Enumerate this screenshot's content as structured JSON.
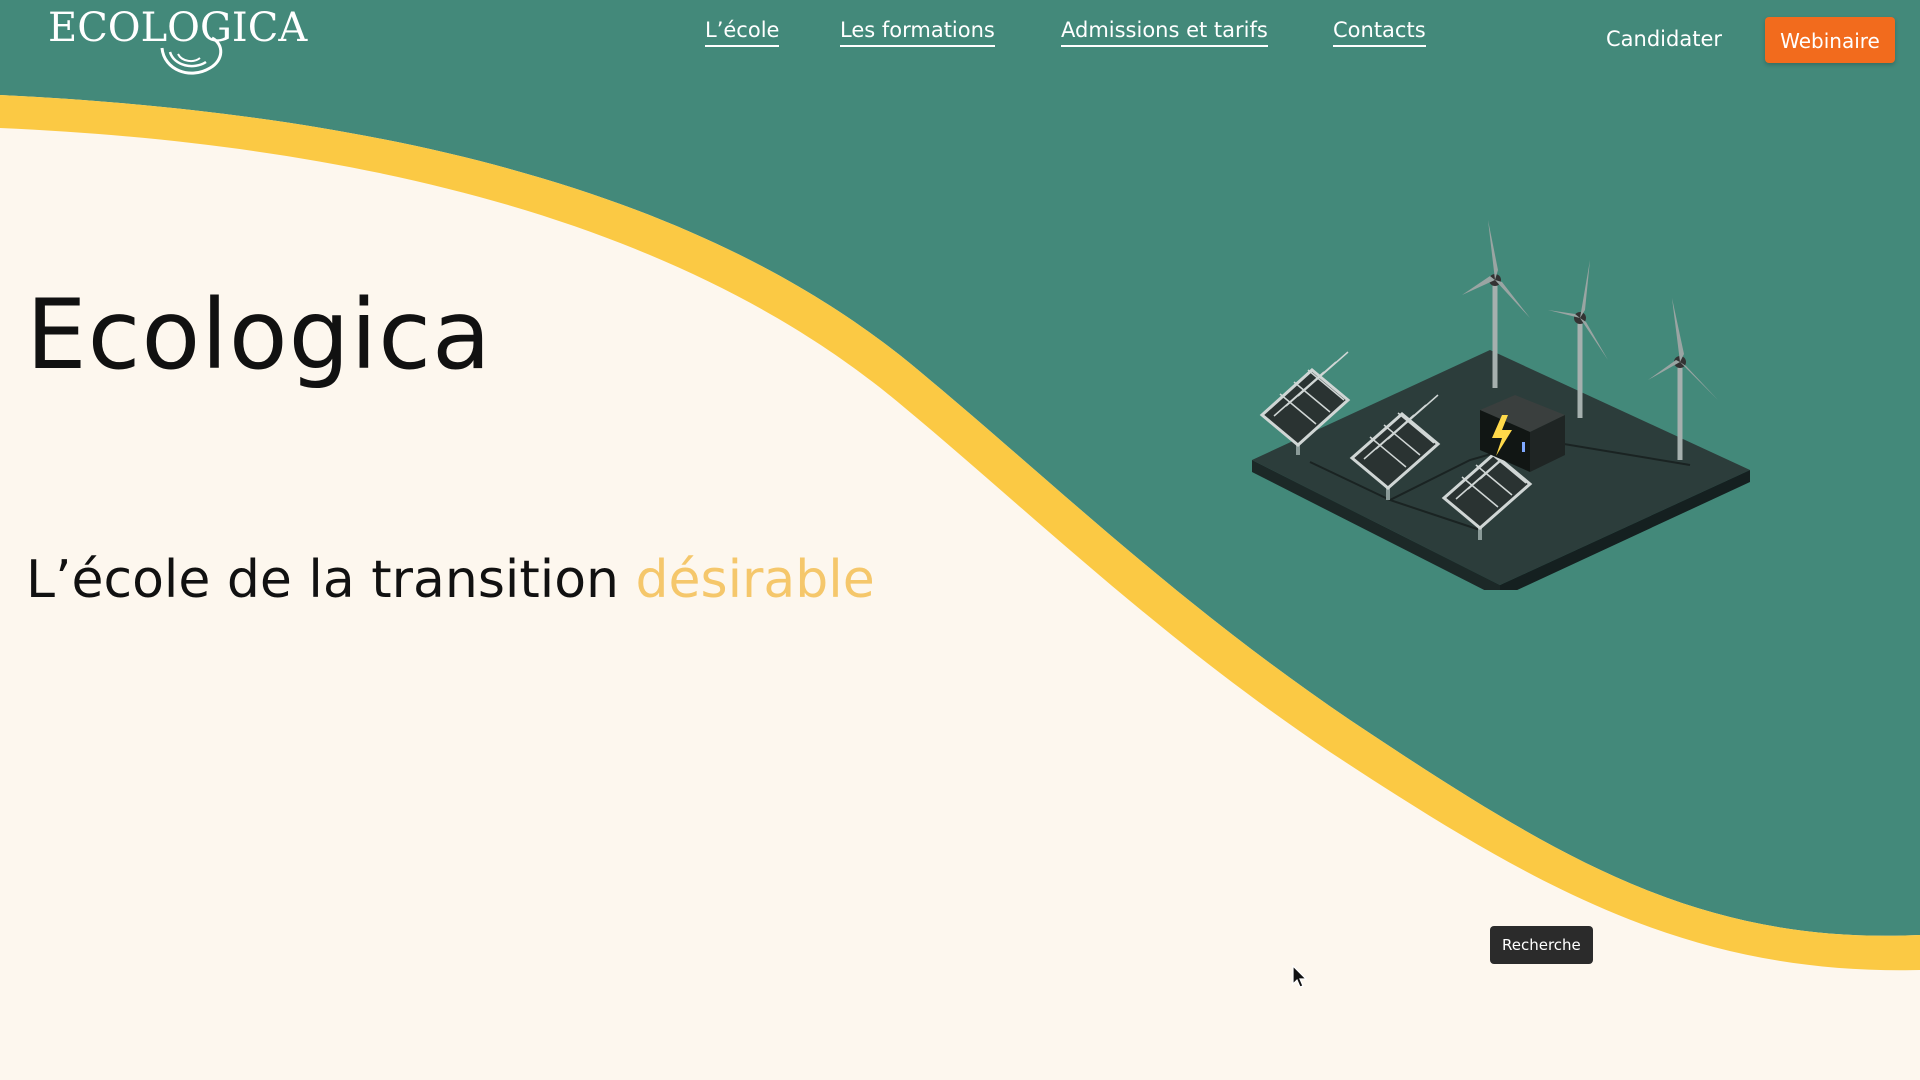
{
  "header": {
    "logo_text": "ECOLOGICA",
    "nav": [
      {
        "label": "L’école"
      },
      {
        "label": "Les formations"
      },
      {
        "label": "Admissions et tarifs"
      },
      {
        "label": "Contacts"
      }
    ],
    "candidater_label": "Candidater",
    "webinaire_label": "Webinaire"
  },
  "hero": {
    "title": "Ecologica",
    "subtitle_prefix": "L’école de la transition ",
    "subtitle_accent": "désirable"
  },
  "tooltip": {
    "text": "Recherche"
  },
  "illustration": {
    "icon": "renewable-energy-illustration"
  },
  "colors": {
    "teal": "#43897a",
    "yellow": "#fbc944",
    "cream": "#fdf7ee",
    "accent_orange": "#f26b1d",
    "accent_text": "#f5c76b"
  }
}
